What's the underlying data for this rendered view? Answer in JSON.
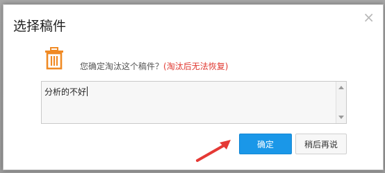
{
  "dialog": {
    "title": "选择稿件",
    "close_icon": "close-icon",
    "trash_icon": "trash-icon",
    "confirm_text": "您确定淘汰这个稿件？",
    "warn_text": "(淘汰后无法恢复)",
    "textarea_value": "分析的不好",
    "ok_label": "确定",
    "later_label": "稍后再说"
  },
  "colors": {
    "accent": "#1a97e8",
    "warn": "#e0372f",
    "icon": "#f08a24",
    "annotation": "#e53935"
  }
}
